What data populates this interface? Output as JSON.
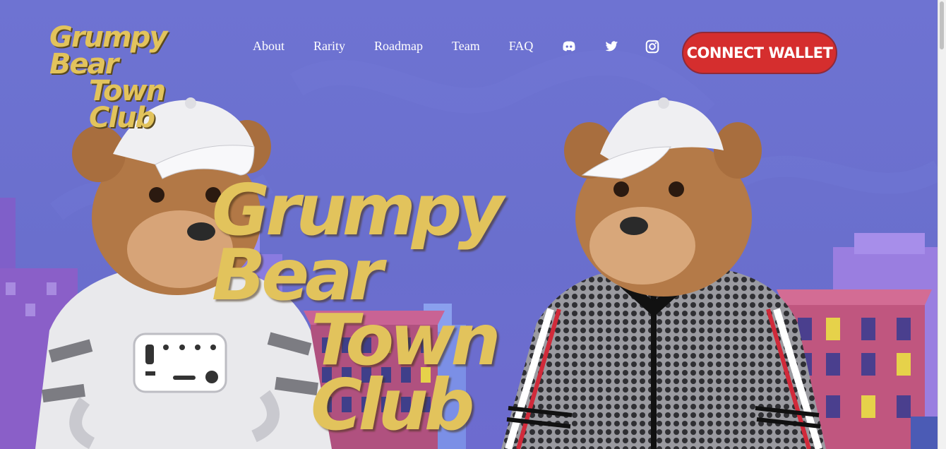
{
  "header": {
    "logo_line1": "Grumpy Bear",
    "logo_line2": "Town Club",
    "nav": [
      {
        "label": "About"
      },
      {
        "label": "Rarity"
      },
      {
        "label": "Roadmap"
      },
      {
        "label": "Team"
      },
      {
        "label": "FAQ"
      }
    ],
    "social_icons": [
      "discord-icon",
      "twitter-icon",
      "instagram-icon"
    ],
    "connect_label": "CONNECT WALLET"
  },
  "hero": {
    "title_line1": "Grumpy Bear",
    "title_line2": "Town Club"
  },
  "colors": {
    "background": "#6a70cf",
    "brand_gold": "#e2c35c",
    "button_red": "#d52e2e",
    "nav_text": "#ffffff"
  }
}
